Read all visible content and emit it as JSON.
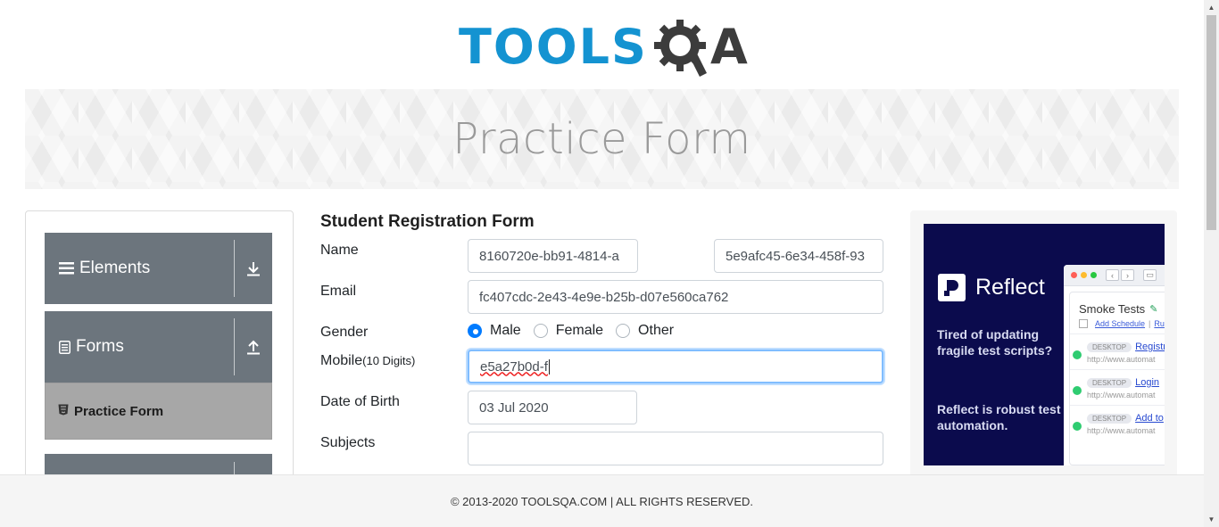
{
  "header": {
    "logo_text_blue": "TOOLS",
    "logo_text_dark": "A"
  },
  "banner": {
    "title": "Practice Form"
  },
  "sidebar": {
    "groups": [
      {
        "label": "Elements",
        "icon": "hamburger-icon",
        "arrow": "download-arrow-icon"
      },
      {
        "label": "Forms",
        "icon": "document-icon",
        "arrow": "upload-arrow-icon"
      }
    ],
    "active_item": {
      "label": "Practice Form",
      "icon": "html5-shield-icon"
    }
  },
  "form": {
    "title": "Student Registration Form",
    "name_label": "Name",
    "first_name": "8160720e-bb91-4814-a",
    "last_name": "5e9afc45-6e34-458f-93",
    "email_label": "Email",
    "email": "fc407cdc-2e43-4e9e-b25b-d07e560ca762",
    "gender_label": "Gender",
    "gender_options": [
      "Male",
      "Female",
      "Other"
    ],
    "gender_selected": "Male",
    "mobile_label": "Mobile",
    "mobile_hint": "(10 Digits)",
    "mobile": "e5a27b0d-f",
    "dob_label": "Date of Birth",
    "dob": "03 Jul 2020",
    "subjects_label": "Subjects",
    "subjects": ""
  },
  "ad": {
    "brand": "Reflect",
    "text1": "Tired of updating fragile test scripts?",
    "text2": "Reflect is robust test automation.",
    "window_title": "Smoke Tests",
    "add_schedule": "Add Schedule",
    "run": "Ru",
    "rows": [
      {
        "tag": "DESKTOP",
        "link": "Registr",
        "url": "http://www.automat"
      },
      {
        "tag": "DESKTOP",
        "link": "Login",
        "url": "http://www.automat"
      },
      {
        "tag": "DESKTOP",
        "link": "Add to",
        "url": "http://www.automat"
      }
    ]
  },
  "footer": {
    "text": "© 2013-2020 TOOLSQA.COM | ALL RIGHTS RESERVED."
  },
  "colors": {
    "accent": "#1493d1",
    "sidebar_group": "#6c757d",
    "active_item": "#a7a7a7",
    "radio_on": "#007bff",
    "ad_bg": "#0b0b4d"
  }
}
